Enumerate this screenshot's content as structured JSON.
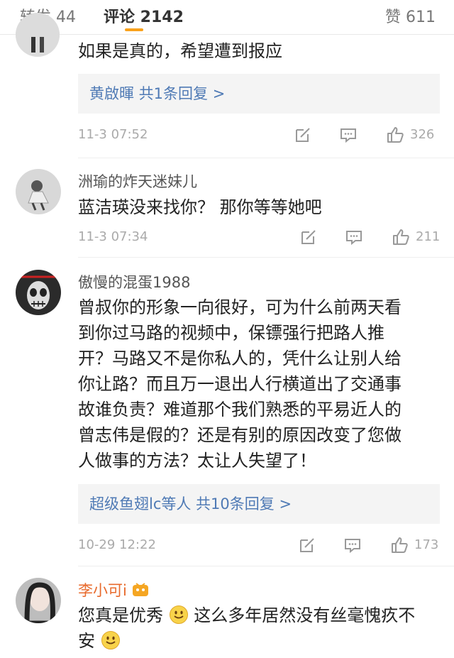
{
  "tabs": {
    "repost_label": "转发 44",
    "comment_label": "评论 2142",
    "like_label": "赞 611"
  },
  "comments": [
    {
      "text": "如果是真的，希望遭到报应",
      "reply_box": "黄啟暉 共1条回复 >",
      "time": "11-3 07:52",
      "likes": "326"
    },
    {
      "username": "洲瑜的炸天迷妹儿",
      "text": "蓝洁瑛没来找你？ 那你等等她吧",
      "time": "11-3 07:34",
      "likes": "211"
    },
    {
      "username": "傲慢的混蛋1988",
      "text": "曾叔你的形象一向很好，可为什么前两天看\n到你过马路的视频中，保镖强行把路人推\n开？马路又不是你私人的，凭什么让别人给\n你让路？而且万一退出人行横道出了交通事\n故谁负责？难道那个我们熟悉的平易近人的\n曾志伟是假的？还是有别的原因改变了您做\n人做事的方法？太让人失望了！",
      "reply_box": "超级鱼翅lc等人 共10条回复 >",
      "time": "10-29 12:22",
      "likes": "173"
    },
    {
      "username": "李小可i",
      "text_part1": "您真是优秀",
      "text_part2": " 这么多年居然没有丝毫愧疚不",
      "text_part3": "安"
    }
  ],
  "icons": {
    "repost": "repost-icon",
    "reply": "comment-icon",
    "like": "thumbs-up-icon",
    "emoji": "smile-emoji-icon"
  },
  "colors": {
    "accent": "#f9a11b",
    "link": "#4f7ab5",
    "username_highlight": "#e86a2c"
  }
}
